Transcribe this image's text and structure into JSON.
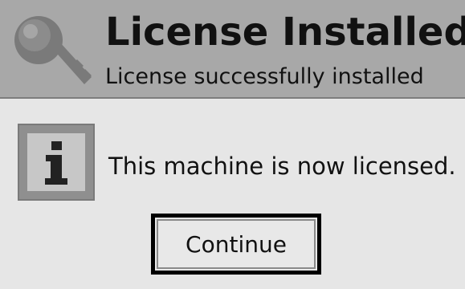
{
  "header": {
    "title": "License Installed",
    "subtitle": "License successfully installed",
    "icon": "key-icon"
  },
  "body": {
    "icon": "info-icon",
    "message": "This machine is now licensed."
  },
  "actions": {
    "continue_label": "Continue"
  },
  "colors": {
    "header_bg": "#a8a8a8",
    "body_bg": "#e6e6e6",
    "icon_gray": "#8f8f8f"
  }
}
